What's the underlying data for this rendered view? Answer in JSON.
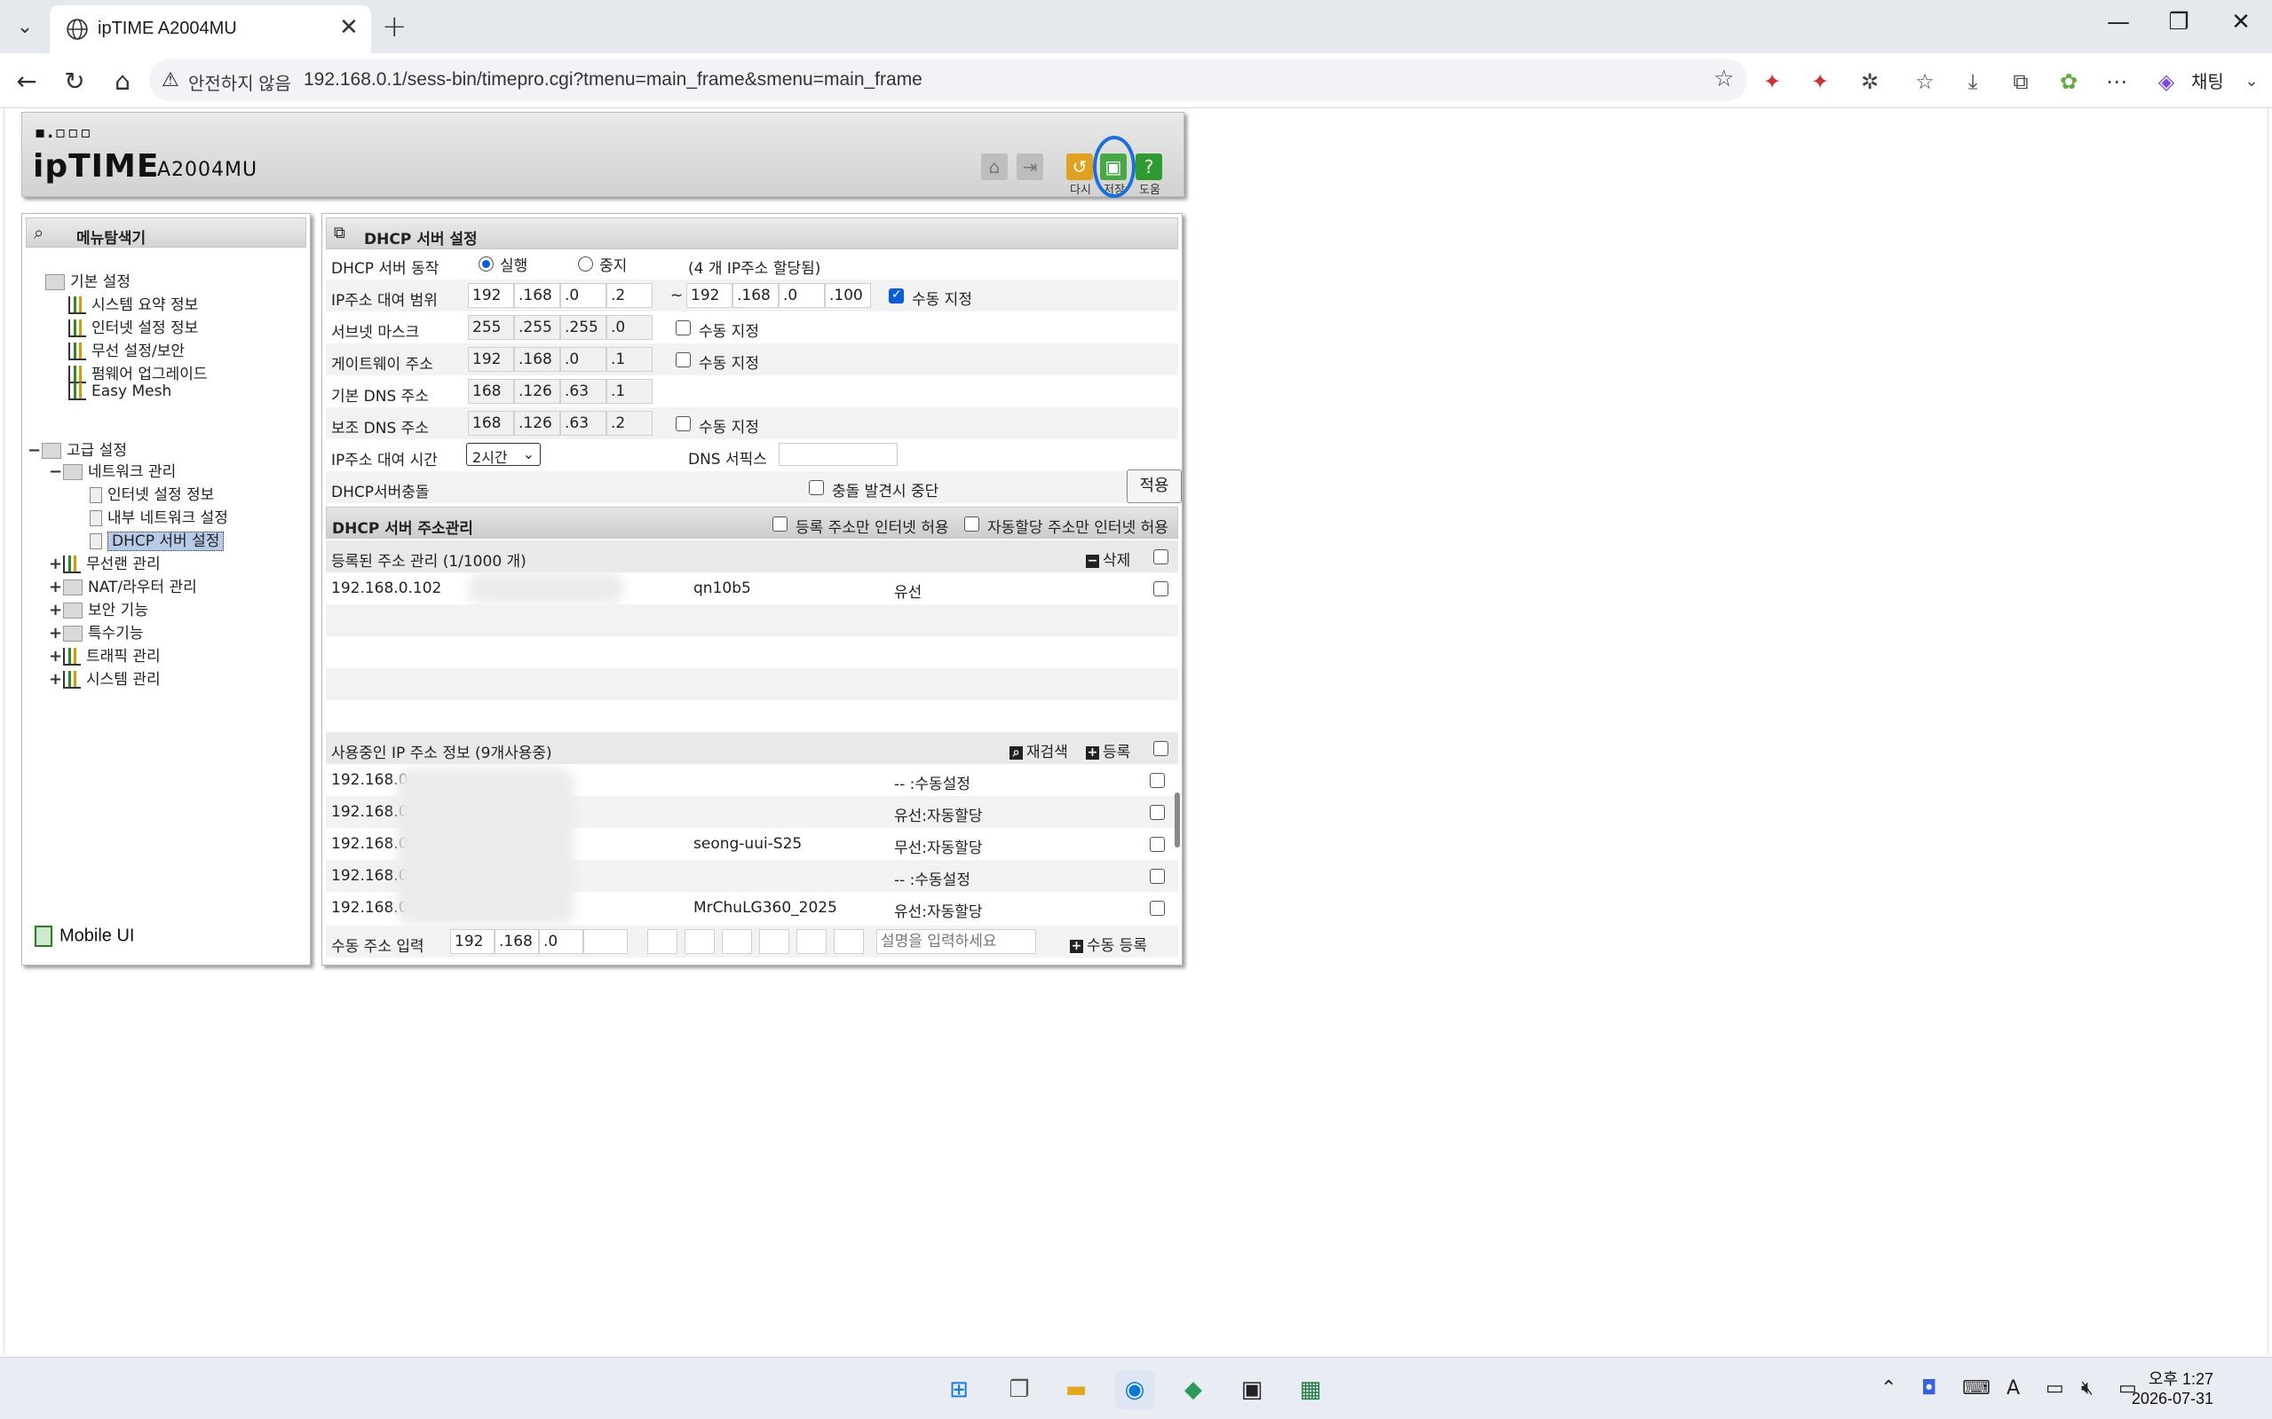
{
  "browser": {
    "tab_title": "ipTIME A2004MU",
    "not_secure_label": "안전하지 않음",
    "url": "192.168.0.1/sess-bin/timepro.cgi?tmenu=main_frame&smenu=main_frame",
    "chat_label": "채팅"
  },
  "router_header": {
    "logo_dots": "▪.▫▫▫",
    "logo_brand": "ipTIME",
    "logo_model": "A2004MU",
    "buttons": {
      "restart": "다시",
      "save": "저장",
      "help": "도움"
    }
  },
  "menu": {
    "title": "메뉴탐색기",
    "basic": {
      "label": "기본 설정",
      "items": [
        "시스템 요약 정보",
        "인터넷 설정 정보",
        "무선 설정/보안",
        "펌웨어 업그레이드",
        "Easy Mesh"
      ]
    },
    "advanced": {
      "label": "고급 설정",
      "network": {
        "label": "네트워크 관리",
        "items": [
          "인터넷 설정 정보",
          "내부 네트워크 설정",
          "DHCP 서버 설정"
        ]
      },
      "groups": [
        "무선랜 관리",
        "NAT/라우터 관리",
        "보안 기능",
        "특수기능",
        "트래픽 관리",
        "시스템 관리"
      ]
    },
    "mobile_ui": "Mobile UI"
  },
  "dhcp": {
    "title": "DHCP 서버 설정",
    "operation": {
      "label": "DHCP 서버 동작",
      "run": "실행",
      "stop": "중지",
      "note": "(4 개 IP주소 할당됨)"
    },
    "range": {
      "label": "IP주소 대여 범위",
      "start": [
        "192",
        ".168",
        ".0",
        ".2"
      ],
      "tilde": "~",
      "end": [
        "192",
        ".168",
        ".0",
        ".100"
      ],
      "manual": "수동 지정"
    },
    "subnet": {
      "label": "서브넷 마스크",
      "octets": [
        "255",
        ".255",
        ".255",
        ".0"
      ],
      "manual": "수동 지정"
    },
    "gateway": {
      "label": "게이트웨이 주소",
      "octets": [
        "192",
        ".168",
        ".0",
        ".1"
      ],
      "manual": "수동 지정"
    },
    "dns1": {
      "label": "기본 DNS 주소",
      "octets": [
        "168",
        ".126",
        ".63",
        ".1"
      ]
    },
    "dns2": {
      "label": "보조 DNS 주소",
      "octets": [
        "168",
        ".126",
        ".63",
        ".2"
      ],
      "manual": "수동 지정"
    },
    "lease": {
      "label": "IP주소 대여 시간",
      "value": "2시간",
      "dns_suffix": "DNS 서픽스"
    },
    "conflict": {
      "label": "DHCP서버충돌",
      "option": "충돌 발견시 중단",
      "apply": "적용"
    }
  },
  "addr_mgmt": {
    "title": "DHCP 서버 주소관리",
    "opt_registered": "등록 주소만 인터넷 허용",
    "opt_auto": "자동할당 주소만 인터넷 허용",
    "registered_header": "등록된 주소 관리 (1/1000 개)",
    "delete": "삭제",
    "registered": [
      {
        "ip": "192.168.0.102",
        "name": "qn10b5",
        "type": "유선"
      }
    ],
    "inuse_header": "사용중인 IP 주소 정보 (9개사용중)",
    "rescan": "재검색",
    "register": "등록",
    "inuse": [
      {
        "ip": "192.168.0",
        "name": "",
        "type": "-- :수동설정"
      },
      {
        "ip": "192.168.0",
        "name": "",
        "type": "유선:자동할당"
      },
      {
        "ip": "192.168.0",
        "name": "seong-uui-S25",
        "type": "무선:자동할당"
      },
      {
        "ip": "192.168.0",
        "name": "",
        "type": "-- :수동설정"
      },
      {
        "ip": "192.168.0",
        "name": "MrChuLG360_2025",
        "type": "유선:자동할당"
      }
    ],
    "manual_label": "수동 주소 입력",
    "manual_octets": [
      "192",
      ".168",
      ".0"
    ],
    "desc_placeholder": "설명을 입력하세요",
    "manual_register": "수동 등록"
  },
  "taskbar": {
    "time": "오후 1:27",
    "date": "2026-07-31"
  }
}
